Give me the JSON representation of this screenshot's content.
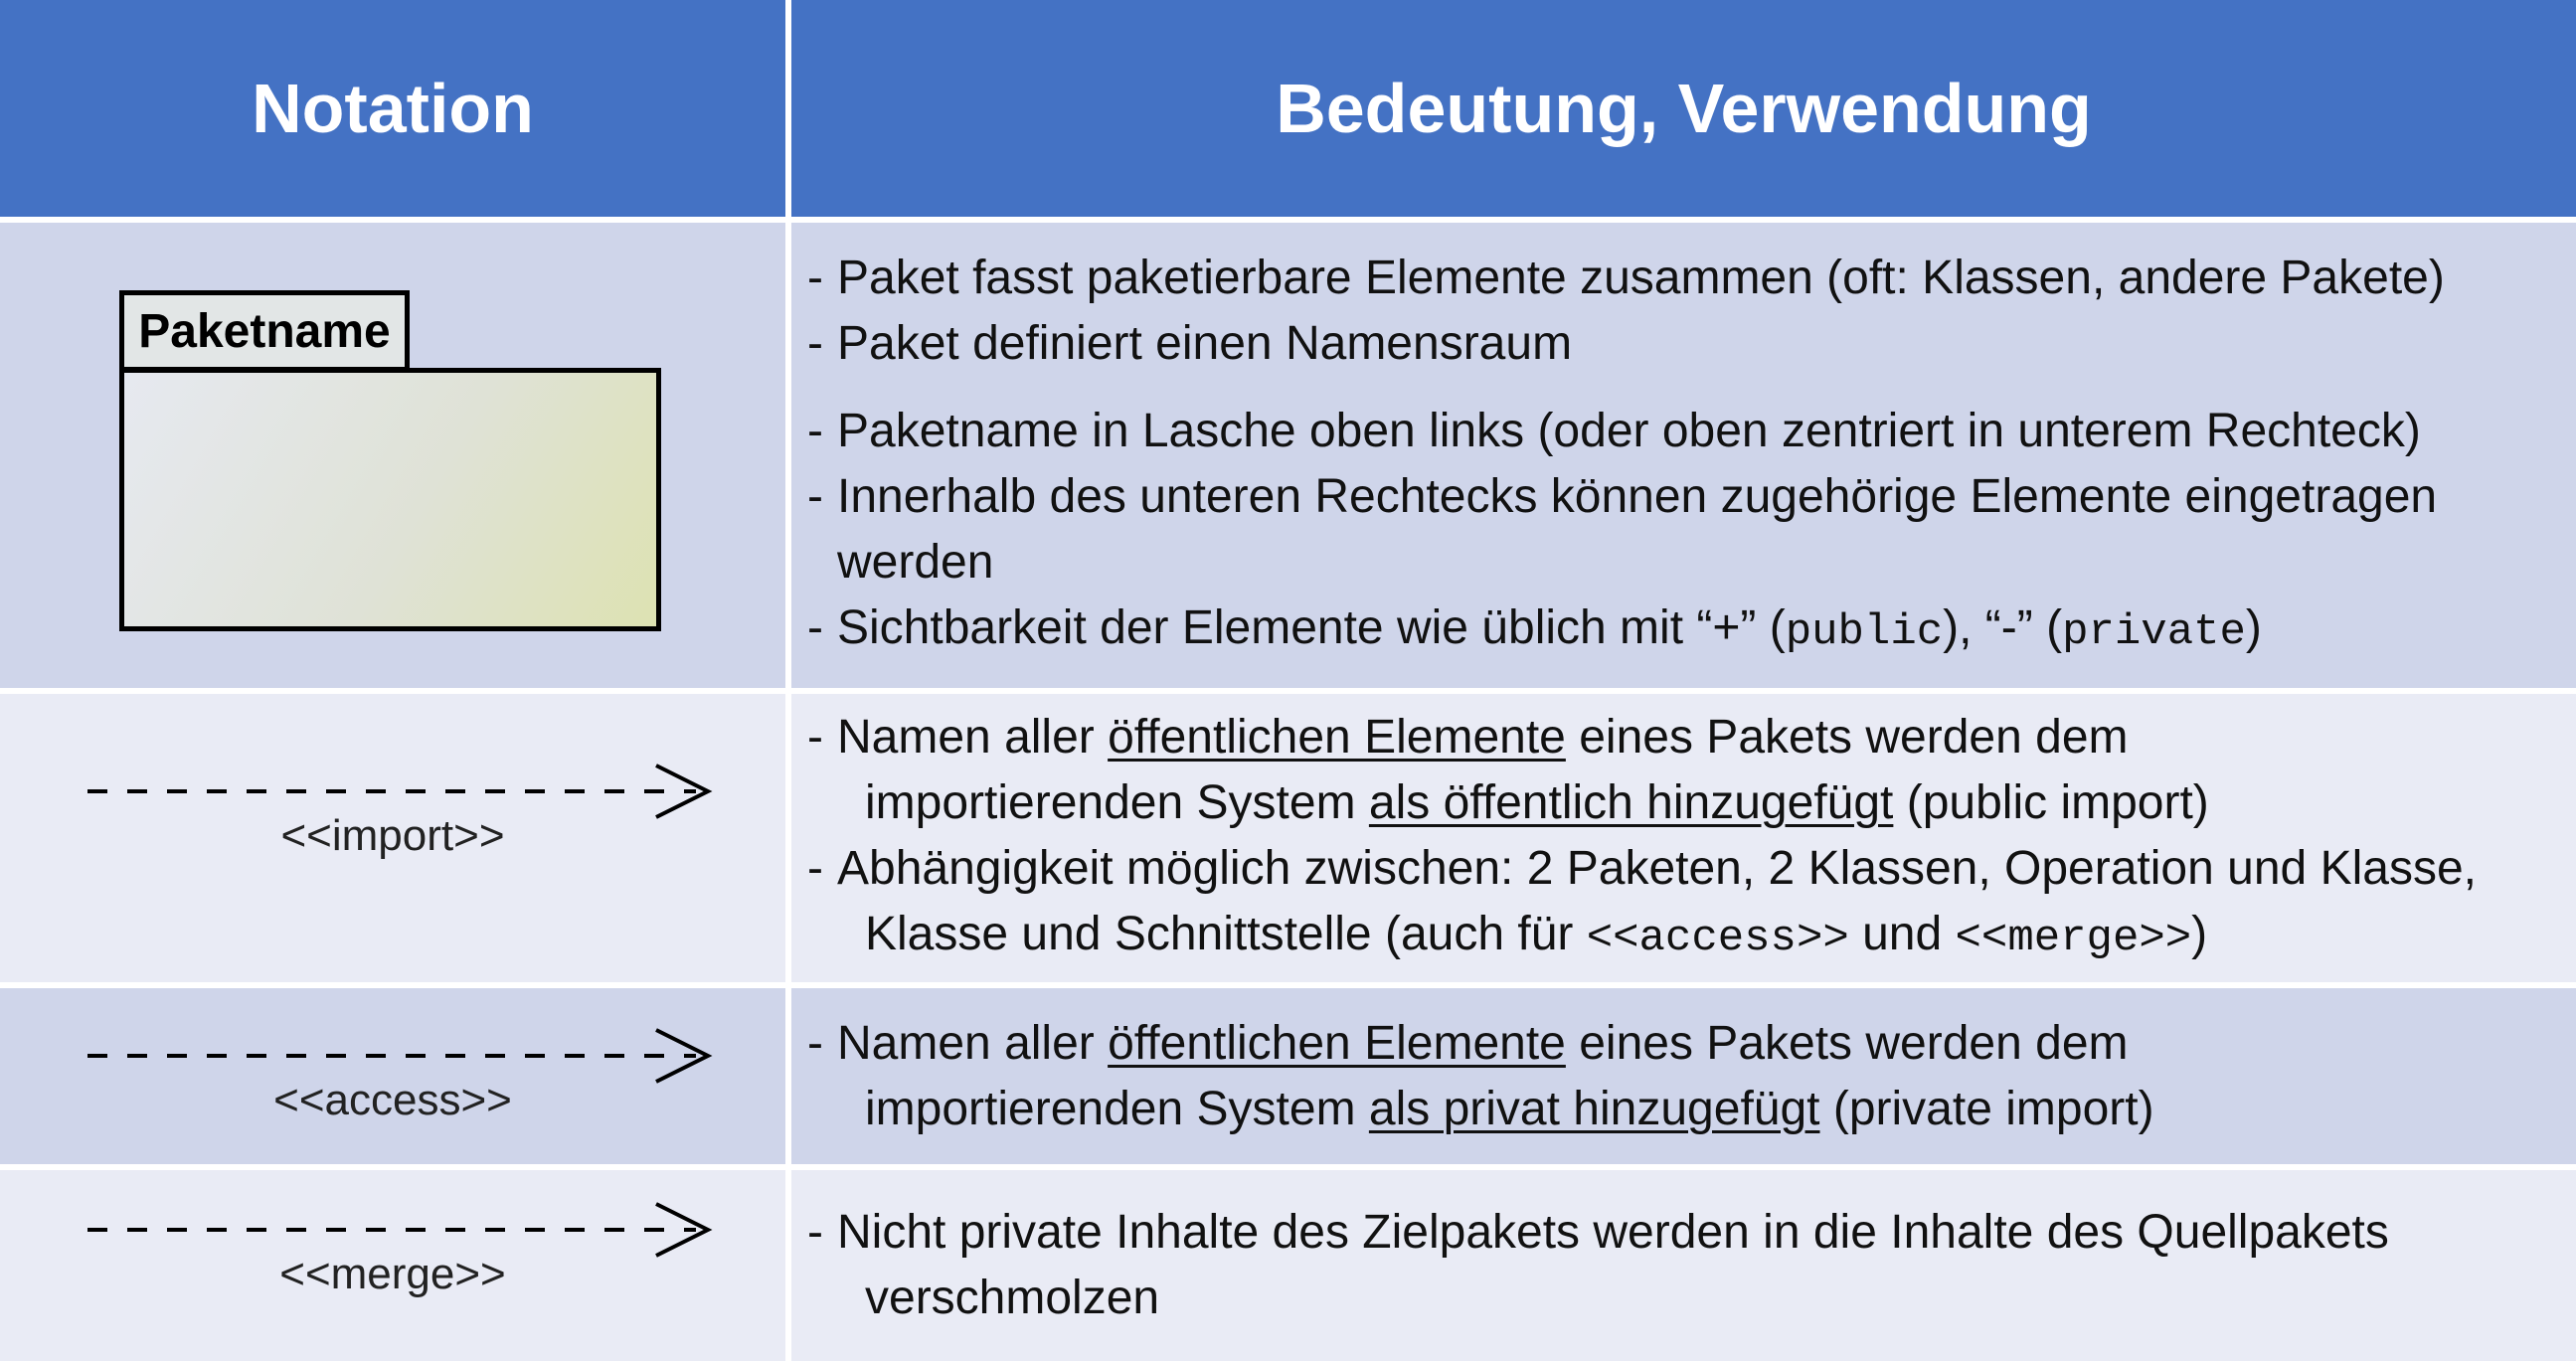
{
  "header": {
    "col_notation": "Notation",
    "col_meaning": "Bedeutung, Verwendung"
  },
  "colors": {
    "header_bg": "#4472c4",
    "band_dark": "#cfd5ea",
    "band_light": "#e9ebf5"
  },
  "rows": {
    "package": {
      "symbol_label": "Paketname",
      "lines": [
        "Paket fasst paketierbare Elemente zusammen (oft: Klassen, andere Pakete)",
        "Paket definiert einen Namensraum",
        "Paketname in Lasche oben links (oder oben zentriert in unterem Rechteck)",
        "Innerhalb des unteren Rechtecks können zugehörige Elemente eingetragen",
        "werden"
      ],
      "visibility": {
        "prefix": "Sichtbarkeit der Elemente wie üblich mit “+” (",
        "public": "public",
        "middle": "), “-” (",
        "private": "private",
        "suffix": ")"
      }
    },
    "import": {
      "symbol_label": "<<import>>",
      "line1_a": "Namen aller ",
      "line1_u": "öffentlichen Elemente",
      "line1_b": " eines Pakets werden dem",
      "line2_a": "importierenden System ",
      "line2_u": "als öffentlich hinzugefügt",
      "line2_b": " (public import)",
      "line3": "Abhängigkeit möglich zwischen: 2 Paketen, 2 Klassen, Operation und Klasse,",
      "line4_a": "Klasse und Schnittstelle (auch für ",
      "line4_m1": "<<access>>",
      "line4_b": " und ",
      "line4_m2": "<<merge>>",
      "line4_c": ")"
    },
    "access": {
      "symbol_label": "<<access>>",
      "line1_a": "Namen aller ",
      "line1_u": "öffentlichen Elemente",
      "line1_b": " eines Pakets werden dem",
      "line2_a": "importierenden System ",
      "line2_u": "als privat hinzugefügt",
      "line2_b": " (private import)"
    },
    "merge": {
      "symbol_label": "<<merge>>",
      "line1": "Nicht private Inhalte des Zielpakets werden in die Inhalte des Quellpakets",
      "line2": "verschmolzen"
    }
  }
}
